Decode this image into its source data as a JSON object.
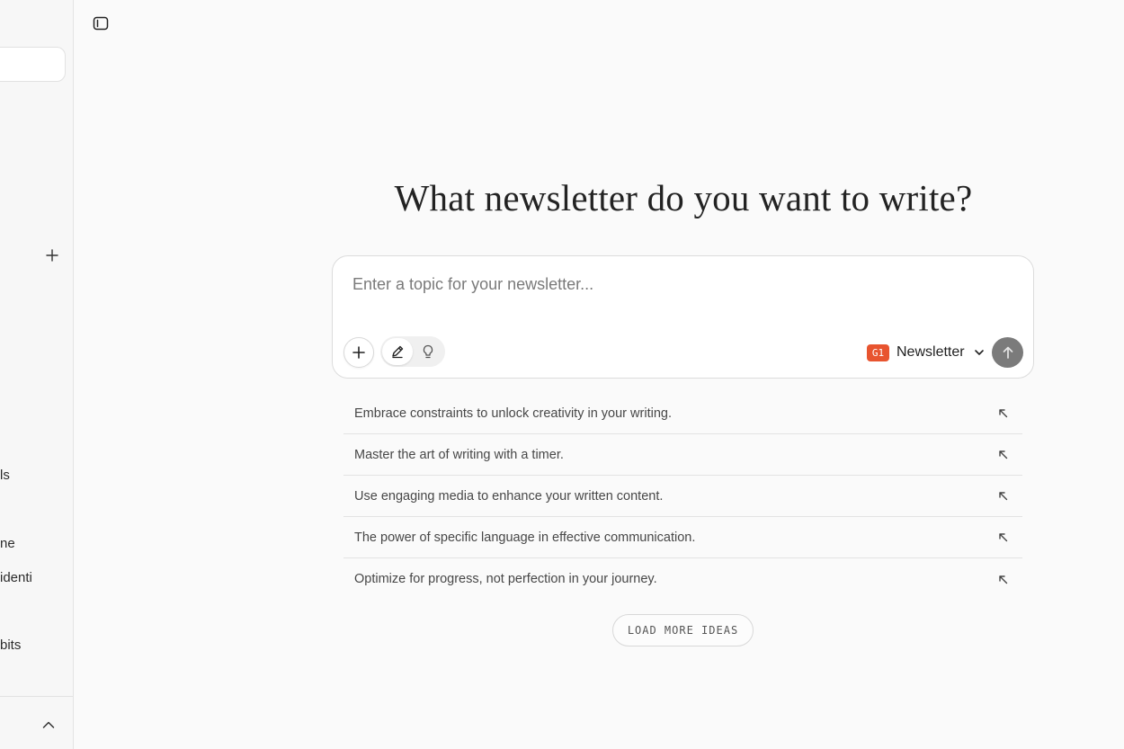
{
  "colors": {
    "accent": "#e8542f",
    "send_button": "#7b7b7b",
    "background": "#fafafa"
  },
  "sidebar": {
    "add_icon": "plus-icon",
    "items": [
      {
        "label": "ls"
      },
      {
        "label": "ne"
      },
      {
        "label": "identi"
      },
      {
        "label": "bits"
      }
    ],
    "footer_icon": "chevron-up-icon"
  },
  "toolbar": {
    "toggle_icon": "sidebar-toggle-icon"
  },
  "main": {
    "headline": "What newsletter do you want to write?",
    "composer": {
      "placeholder": "Enter a topic for your newsletter...",
      "value": "",
      "attach_icon": "plus-icon",
      "modes": [
        {
          "icon": "pencil-icon",
          "active": true
        },
        {
          "icon": "lightbulb-icon",
          "active": false
        }
      ],
      "format": {
        "badge": "G1",
        "label": "Newsletter",
        "icon": "chevron-down-icon"
      },
      "send_icon": "arrow-up-icon"
    },
    "ideas": [
      {
        "text": "Embrace constraints to unlock creativity in your writing.",
        "icon": "arrow-up-left-icon"
      },
      {
        "text": "Master the art of writing with a timer.",
        "icon": "arrow-up-left-icon"
      },
      {
        "text": "Use engaging media to enhance your written content.",
        "icon": "arrow-up-left-icon"
      },
      {
        "text": "The power of specific language in effective communication.",
        "icon": "arrow-up-left-icon"
      },
      {
        "text": "Optimize for progress, not perfection in your journey.",
        "icon": "arrow-up-left-icon"
      }
    ],
    "load_more_label": "LOAD MORE IDEAS"
  }
}
